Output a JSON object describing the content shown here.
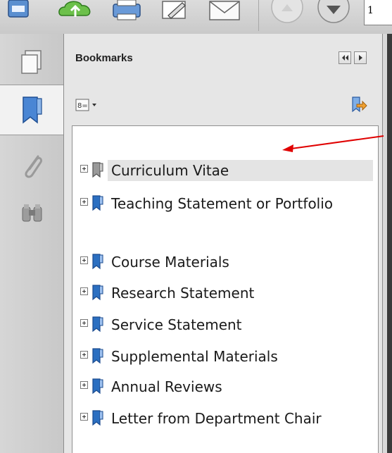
{
  "toolbar": {
    "page_number": "1"
  },
  "panel": {
    "title": "Bookmarks"
  },
  "bookmarks": [
    {
      "label": "Curriculum Vitae"
    },
    {
      "label": "Teaching Statement or Portfolio"
    },
    {
      "label": "Course Materials"
    },
    {
      "label": "Research Statement"
    },
    {
      "label": "Service Statement"
    },
    {
      "label": "Supplemental Materials"
    },
    {
      "label": "Annual Reviews"
    },
    {
      "label": "Letter from Department Chair"
    }
  ],
  "colors": {
    "bookmark_icon": "#2b6fc1",
    "annotation_arrow": "#e00000",
    "selected_row": "#e4e4e4",
    "toolbar_bg": "#d0d0d0"
  },
  "icons": {
    "nav": [
      "pages-icon",
      "bookmark-icon",
      "attachment-icon",
      "binoculars-icon"
    ],
    "toolbar": [
      "save-icon",
      "upload-icon",
      "print-icon",
      "edit-icon",
      "email-icon",
      "previous-page-icon",
      "next-page-icon"
    ]
  }
}
